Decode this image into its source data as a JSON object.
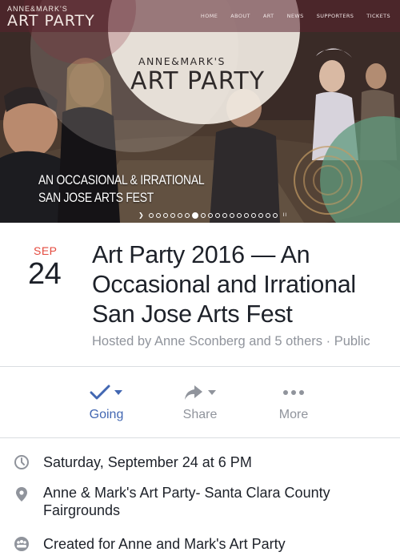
{
  "site": {
    "logo_small": "ANNE&MARK'S",
    "logo_big": "ART PARTY",
    "nav": [
      "HOME",
      "ABOUT",
      "ART",
      "NEWS",
      "SUPPORTERS",
      "TICKETS"
    ]
  },
  "poster": {
    "title_small": "ANNE&MARK'S",
    "title_big": "ART PARTY",
    "tagline_line1": "AN OCCASIONAL & IRRATIONAL",
    "tagline_line2": "SAN JOSE ARTS FEST",
    "slider_pause": "II"
  },
  "event": {
    "month": "SEP",
    "day": "24",
    "title": "Art Party 2016 — An Occasional and Irrational San Jose Arts Fest",
    "hosted_by": "Hosted by Anne Sconberg and 5 others · Public"
  },
  "actions": {
    "going": {
      "label": "Going",
      "icon": "checkmark-icon"
    },
    "share": {
      "label": "Share",
      "icon": "share-arrow-icon"
    },
    "more": {
      "label": "More",
      "icon": "ellipsis-icon"
    }
  },
  "details": {
    "time": "Saturday, September 24 at 6 PM",
    "location": "Anne & Mark's Art Party- Santa Clara County Fairgrounds",
    "created_for": "Created for Anne and Mark's Art Party"
  },
  "colors": {
    "accent_blue": "#4267b2",
    "date_red": "#e44a3e",
    "muted_gray": "#90949c",
    "text_dark": "#1d2129",
    "divider": "#dadde1"
  }
}
